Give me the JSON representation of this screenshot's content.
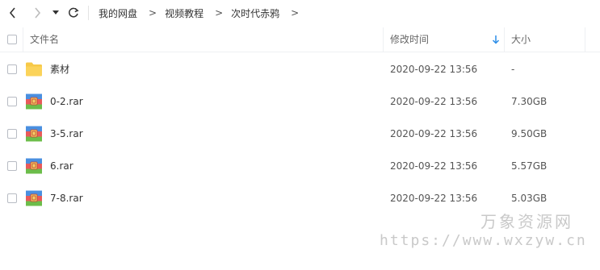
{
  "nav": {
    "back_icon": "chevron-left-icon",
    "forward_icon": "chevron-right-icon",
    "history_icon": "caret-down-icon",
    "refresh_icon": "refresh-icon"
  },
  "breadcrumb": {
    "items": [
      "我的网盘",
      "视频教程",
      "次时代赤鸦"
    ],
    "separator": ">"
  },
  "table": {
    "headers": {
      "name": "文件名",
      "modified": "修改时间",
      "size": "大小"
    },
    "sorted_by": "modified",
    "rows": [
      {
        "name": "素材",
        "type": "folder",
        "modified": "2020-09-22 13:56",
        "size": "-"
      },
      {
        "name": "0-2.rar",
        "type": "rar",
        "modified": "2020-09-22 13:56",
        "size": "7.30GB"
      },
      {
        "name": "3-5.rar",
        "type": "rar",
        "modified": "2020-09-22 13:56",
        "size": "9.50GB"
      },
      {
        "name": "6.rar",
        "type": "rar",
        "modified": "2020-09-22 13:56",
        "size": "5.57GB"
      },
      {
        "name": "7-8.rar",
        "type": "rar",
        "modified": "2020-09-22 13:56",
        "size": "5.03GB"
      }
    ]
  },
  "watermark": {
    "title": "万象资源网",
    "url": "https://www.wxzyw.cn"
  },
  "colors": {
    "folder": "#f7c948",
    "sort_arrow": "#2b8de8"
  }
}
